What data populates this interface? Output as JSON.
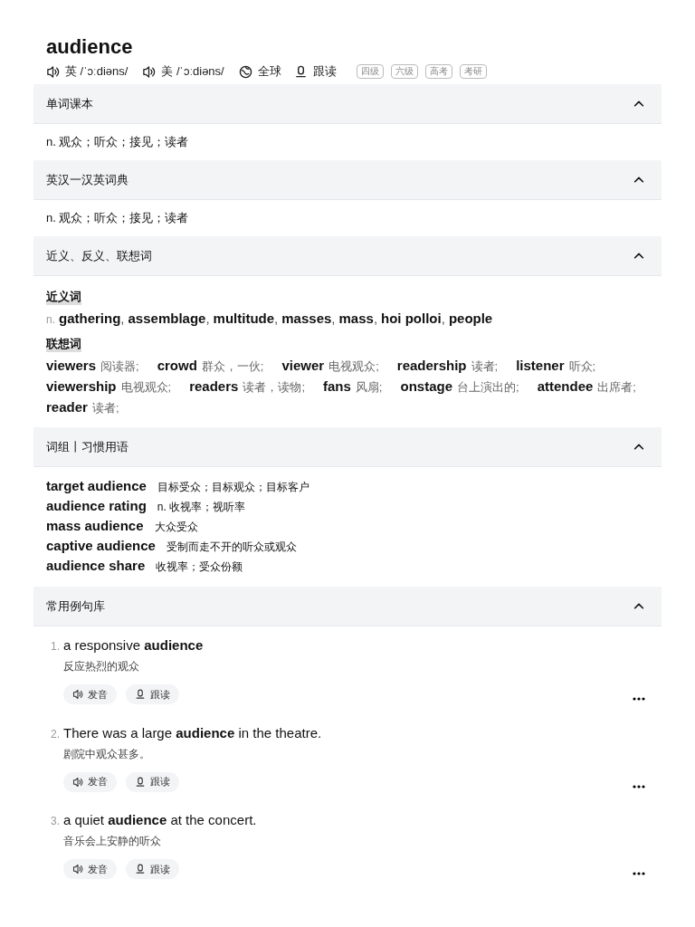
{
  "word": "audience",
  "pronunciations": [
    {
      "region": "英",
      "ipa": "/ˈɔːdiəns/"
    },
    {
      "region": "美",
      "ipa": "/ˈɔːdiəns/"
    }
  ],
  "actions": [
    {
      "kind": "global",
      "label": "全球"
    },
    {
      "kind": "follow",
      "label": "跟读"
    }
  ],
  "tags": [
    "四级",
    "六级",
    "高考",
    "考研"
  ],
  "sections": [
    {
      "title": "单词课本",
      "expanded": true,
      "kind": "definition",
      "text": "n. 观众；听众；接见；读者"
    },
    {
      "title": "英汉一汉英词典",
      "expanded": true,
      "kind": "definition",
      "text": "n. 观众；听众；接见；读者"
    },
    {
      "title": "近义、反义、联想词",
      "expanded": true,
      "kind": "related",
      "synonyms_label": "近义词",
      "pos": "n.",
      "synonyms": [
        {
          "word": "gathering",
          "separator": ","
        },
        {
          "word": "assemblage",
          "separator": ","
        },
        {
          "word": "multitude",
          "separator": ","
        },
        {
          "word": "masses",
          "separator": ","
        },
        {
          "word": "mass",
          "separator": ","
        },
        {
          "word": "hoi polloi",
          "separator": ","
        },
        {
          "word": "people"
        }
      ],
      "associations_label": "联想词",
      "associations": [
        {
          "word": "viewers",
          "meaning": "阅读器;"
        },
        {
          "word": "crowd",
          "meaning": "群众，一伙;"
        },
        {
          "word": "viewer",
          "meaning": "电视观众;"
        },
        {
          "word": "readership",
          "meaning": "读者;"
        },
        {
          "word": "listener",
          "meaning": "听众;"
        },
        {
          "word": "viewership",
          "meaning": "电视观众;"
        },
        {
          "word": "readers",
          "meaning": "读者，读物;"
        },
        {
          "word": "fans",
          "meaning": "风扇;"
        },
        {
          "word": "onstage",
          "meaning": "台上演出的;"
        },
        {
          "word": "attendee",
          "meaning": "出席者;"
        },
        {
          "word": "reader",
          "meaning": "读者;"
        }
      ]
    },
    {
      "title": "词组丨习惯用语",
      "expanded": true,
      "kind": "phrases",
      "phrases": [
        {
          "phrase": "target audience",
          "meaning": "目标受众；目标观众；目标客户"
        },
        {
          "phrase": "audience rating",
          "meaning": "n. 收视率；视听率"
        },
        {
          "phrase": "mass audience",
          "meaning": "大众受众"
        },
        {
          "phrase": "captive audience",
          "meaning": "受制而走不开的听众或观众"
        },
        {
          "phrase": "audience share",
          "meaning": "收视率；受众份额"
        }
      ]
    },
    {
      "title": "常用例句库",
      "expanded": true,
      "kind": "examples",
      "examples": [
        {
          "number": "1.",
          "sentence": "a responsive **audience**",
          "translation": "反应热烈的观众",
          "buttons": [
            "发音",
            "跟读"
          ]
        },
        {
          "number": "2.",
          "sentence": "There was a large **audience** in the theatre.",
          "translation": "剧院中观众甚多。",
          "buttons": [
            "发音",
            "跟读"
          ]
        },
        {
          "number": "3.",
          "sentence": "a quiet **audience** at the concert.",
          "translation": "音乐会上安静的听众",
          "buttons": [
            "发音",
            "跟读"
          ]
        }
      ]
    }
  ]
}
